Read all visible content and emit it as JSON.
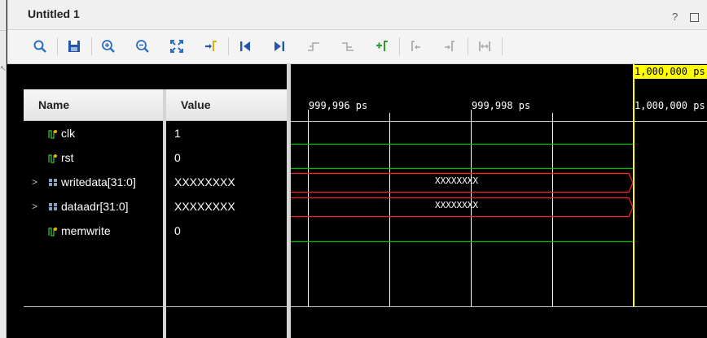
{
  "window": {
    "title": "Untitled 1",
    "help_label": "?"
  },
  "toolbar": {
    "buttons": [
      {
        "name": "search-icon",
        "enabled": true
      },
      {
        "name": "save-icon",
        "enabled": true
      },
      {
        "name": "zoom-in-icon",
        "enabled": true
      },
      {
        "name": "zoom-out-icon",
        "enabled": true
      },
      {
        "name": "zoom-fit-icon",
        "enabled": true
      },
      {
        "name": "go-to-cursor-icon",
        "enabled": true
      },
      {
        "name": "go-to-time-zero-icon",
        "enabled": true
      },
      {
        "name": "go-to-last-time-icon",
        "enabled": true
      },
      {
        "name": "previous-transition-icon",
        "enabled": false
      },
      {
        "name": "next-transition-icon",
        "enabled": false
      },
      {
        "name": "add-marker-icon",
        "enabled": true
      },
      {
        "name": "previous-marker-icon",
        "enabled": false
      },
      {
        "name": "next-marker-icon",
        "enabled": false
      },
      {
        "name": "swap-cursors-icon",
        "enabled": false
      }
    ]
  },
  "columns": {
    "name_header": "Name",
    "value_header": "Value"
  },
  "signals": [
    {
      "name": "clk",
      "value": "1",
      "type": "bit",
      "expandable": false
    },
    {
      "name": "rst",
      "value": "0",
      "type": "bit",
      "expandable": false
    },
    {
      "name": "writedata[31:0]",
      "value": "XXXXXXXX",
      "type": "bus",
      "expandable": true
    },
    {
      "name": "dataadr[31:0]",
      "value": "XXXXXXXX",
      "type": "bus",
      "expandable": true
    },
    {
      "name": "memwrite",
      "value": "0",
      "type": "bit",
      "expandable": false
    }
  ],
  "waveform": {
    "cursor_time": "1,000,000 ps",
    "time_labels": [
      "999,996 ps",
      "999,998 ps",
      "1,000,000 ps"
    ],
    "bus_values": [
      "XXXXXXXX",
      "XXXXXXXX"
    ],
    "colors": {
      "bit_wave": "#00c000",
      "bus_x": "#ff2020",
      "cursor": "#ffff00",
      "grid": "#ffffff"
    }
  }
}
